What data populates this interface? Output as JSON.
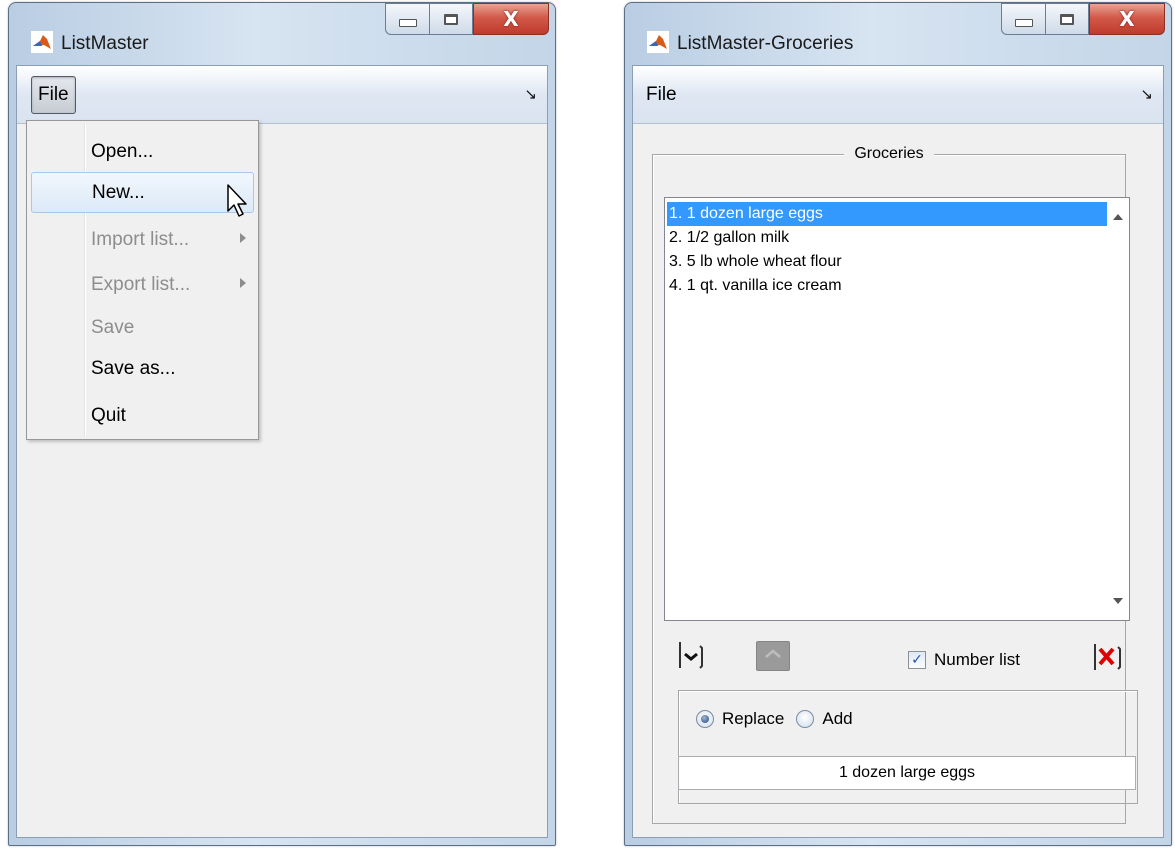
{
  "left_window": {
    "title": "ListMaster",
    "menubar": {
      "file_label": "File",
      "corner_icon": "arrow-down-right-icon"
    },
    "file_menu": {
      "open": true,
      "highlighted": "New...",
      "items": [
        {
          "label": "Open...",
          "enabled": true,
          "submenu": false
        },
        {
          "label": "New...",
          "enabled": true,
          "submenu": false
        },
        {
          "label": "Import list...",
          "enabled": false,
          "submenu": true
        },
        {
          "label": "Export list...",
          "enabled": false,
          "submenu": true
        },
        {
          "label": "Save",
          "enabled": false,
          "submenu": false
        },
        {
          "label": "Save as...",
          "enabled": true,
          "submenu": false
        },
        {
          "label": "Quit",
          "enabled": true,
          "submenu": false
        }
      ]
    }
  },
  "right_window": {
    "title": "ListMaster-Groceries",
    "menubar": {
      "file_label": "File",
      "corner_icon": "arrow-down-right-icon"
    },
    "panel_title": "Groceries",
    "list": {
      "selected_index": 0,
      "items": [
        "1. 1 dozen large eggs",
        "2. 1/2 gallon milk",
        "3. 5 lb whole wheat flour",
        "4. 1 qt. vanilla ice cream"
      ]
    },
    "controls": {
      "move_down_icon": "move-down-icon",
      "move_up_icon": "move-up-icon",
      "number_list_label": "Number list",
      "number_list_checked": true,
      "delete_icon": "delete-x-icon"
    },
    "edit_mode": {
      "options": [
        "Replace",
        "Add"
      ],
      "selected": "Replace"
    },
    "edit_field": {
      "value": "1 dozen large eggs"
    }
  },
  "colors": {
    "selection": "#3399ff",
    "close_button": "#c9483a",
    "delete_icon": "#e00000"
  }
}
